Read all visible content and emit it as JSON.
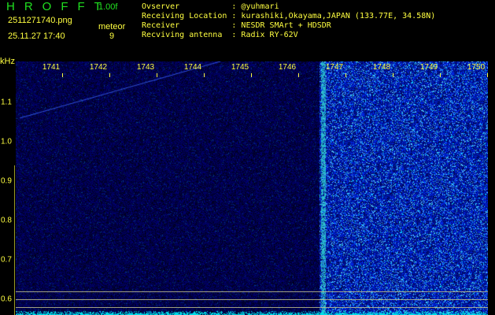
{
  "header": {
    "app_title": "HROFFT",
    "version": "1.00f",
    "filename": "2511271740.png",
    "datetime": "25.11.27 17:40",
    "meteor_label": "meteor",
    "meteor_count": "9"
  },
  "info": [
    {
      "label": "Ovserver           ",
      "value": ": @yuhmari"
    },
    {
      "label": "Receiving Location ",
      "value": ": kurashiki,Okayama,JAPAN (133.77E, 34.58N)"
    },
    {
      "label": "Receiver           ",
      "value": ": NESDR SMArt + HDSDR"
    },
    {
      "label": "Recviving antenna  ",
      "value": ": Radix RY-62V"
    }
  ],
  "axis": {
    "y_unit": "kHz",
    "y_ticks": [
      "1.1",
      "1.0",
      "0.9",
      "0.8",
      "0.7",
      "0.6"
    ],
    "x_ticks": [
      "1741",
      "1742",
      "1743",
      "1744",
      "1745",
      "1746",
      "1747",
      "1748",
      "1749",
      "1750"
    ]
  },
  "colors": {
    "background": "#000000",
    "noise_low": "#0010a0",
    "noise_high": "#2040ff",
    "signal": "#40ffff",
    "label": "#ffff40",
    "title": "#20e020"
  }
}
